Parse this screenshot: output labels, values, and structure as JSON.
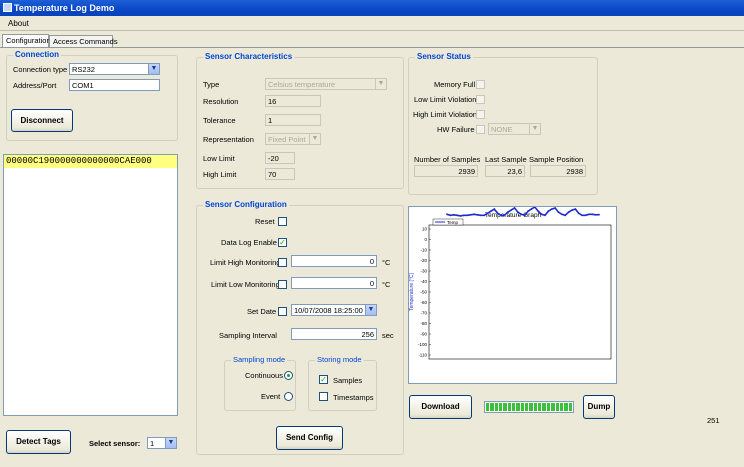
{
  "window": {
    "title": "Temperature Log Demo"
  },
  "menu": {
    "about": "About"
  },
  "tabs": [
    {
      "label": "Configuration"
    },
    {
      "label": "Access Commands"
    }
  ],
  "connection": {
    "title": "Connection",
    "type_label": "Connection type",
    "type_value": "RS232",
    "address_label": "Address/Port",
    "address_value": "COM1",
    "disconnect": "Disconnect"
  },
  "tag_list": {
    "items": [
      "00000C190000000000000CAE000"
    ]
  },
  "sensor_characteristics": {
    "title": "Sensor Characteristics",
    "type_label": "Type",
    "type_value": "Celsius temperature",
    "resolution_label": "Resolution",
    "resolution_value": "16",
    "tolerance_label": "Tolerance",
    "tolerance_value": "1",
    "representation_label": "Representation",
    "representation_value": "Fixed Point",
    "low_limit_label": "Low Limit",
    "low_limit_value": "-20",
    "high_limit_label": "High Limit",
    "high_limit_value": "70"
  },
  "sensor_status": {
    "title": "Sensor Status",
    "memory_full": "Memory Full",
    "low_limit_violation": "Low Limit Violation",
    "high_limit_violation": "High Limit Violation",
    "hw_failure": "HW Failure",
    "hw_failure_value": "NONE",
    "num_samples_label": "Number of Samples",
    "num_samples_value": "2939",
    "last_sample_label": "Last Sample",
    "last_sample_value": "23,6",
    "sample_position_label": "Sample Position",
    "sample_position_value": "2938"
  },
  "sensor_configuration": {
    "title": "Sensor Configuration",
    "reset": "Reset",
    "data_log_enable": "Data Log Enable",
    "data_log_enable_checked": true,
    "limit_high_label": "Limit High Monitoring",
    "limit_high_value": "0",
    "limit_low_label": "Limit Low Monitoring",
    "limit_low_value": "0",
    "unit_c": "°C",
    "set_date_label": "Set Date",
    "set_date_value": "10/07/2008 18:25:00",
    "sampling_interval_label": "Sampling Interval",
    "sampling_interval_value": "256",
    "sampling_interval_unit": "sec",
    "sampling_mode": {
      "title": "Sampling mode",
      "continuous": "Continuous",
      "event": "Event",
      "selected": "continuous"
    },
    "storing_mode": {
      "title": "Storing mode",
      "samples": "Samples",
      "samples_checked": true,
      "timestamps": "Timestamps",
      "timestamps_checked": false
    },
    "send_config": "Send Config"
  },
  "bottom": {
    "detect_tags": "Detect Tags",
    "select_sensor_label": "Select sensor:",
    "select_sensor_value": "1",
    "download": "Download",
    "dump": "Dump",
    "counter": "251",
    "download_progress": 1.0
  },
  "chart_data": {
    "type": "line",
    "title": "Temperature Graph",
    "ylabel": "Temperature [°C]",
    "ylim": [
      -20,
      10
    ],
    "yticks": [
      10,
      0,
      -10,
      -20,
      -30,
      -40,
      -50,
      -60,
      -70,
      -80,
      -90,
      -100,
      -110
    ],
    "legend": "Temp",
    "colors": {
      "series": "#1f2ccc"
    },
    "series": [
      {
        "name": "Temp",
        "values": [
          24,
          23,
          23.5,
          23,
          22.5,
          23,
          23,
          23.5,
          24,
          23.5,
          23,
          23,
          25,
          27,
          29,
          25,
          23,
          23,
          26,
          28,
          30,
          26,
          24,
          23,
          27,
          29,
          31,
          27,
          24,
          23,
          27,
          29,
          30,
          26,
          24,
          23,
          26,
          28,
          29,
          25,
          23,
          23,
          24,
          24,
          23.5,
          23.6
        ]
      }
    ]
  }
}
